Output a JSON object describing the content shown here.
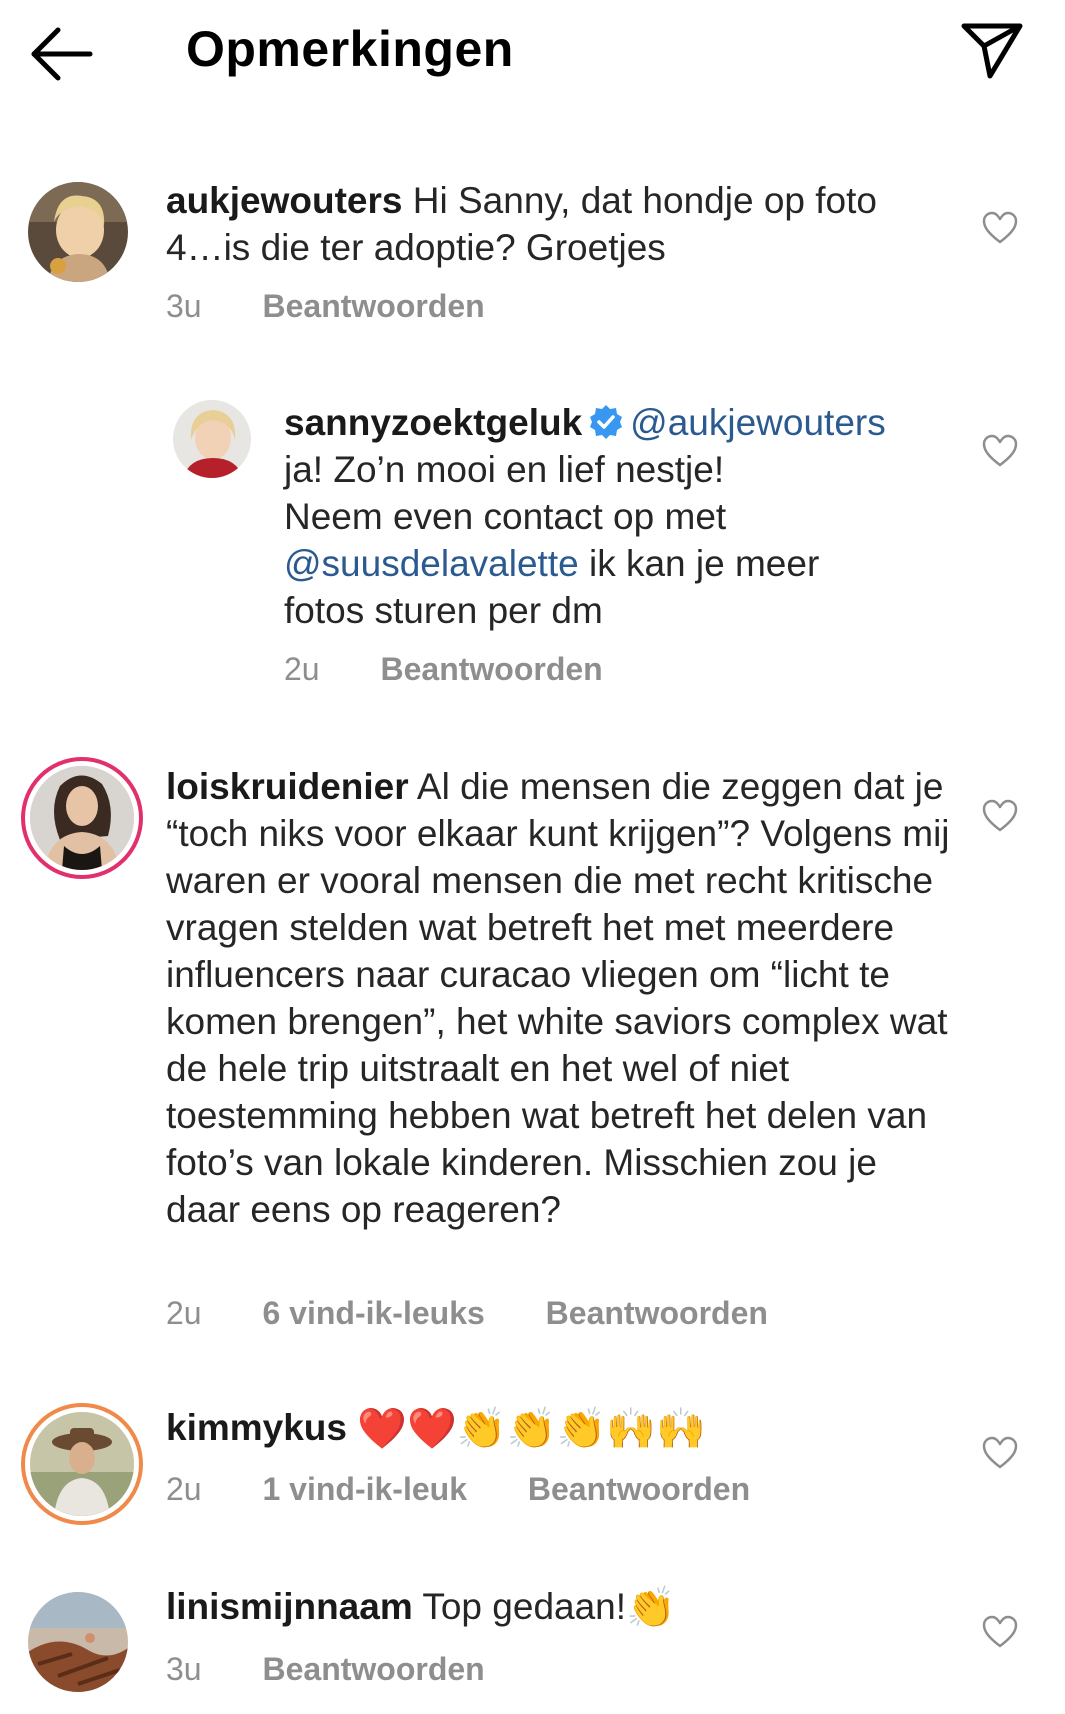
{
  "header": {
    "title": "Opmerkingen"
  },
  "comments": [
    {
      "username": "aukjewouters",
      "text": "Hi Sanny, dat hondje op foto 4…is die ter adoptie? Groetjes",
      "time": "3u",
      "reply_label": "Beantwoorden"
    },
    {
      "username": "sannyzoektgeluk",
      "mention": "@aukjewouters",
      "text_line1": "ja! Zo’n mooi en lief nestje!",
      "text_line2": "Neem even contact op met",
      "mention2": "@suusdelavalette",
      "text_line3": " ik kan je meer",
      "text_line4": "fotos sturen per dm",
      "time": "2u",
      "reply_label": "Beantwoorden"
    },
    {
      "username": "loiskruidenier",
      "text": "Al die mensen die zeggen dat je “toch niks voor elkaar kunt krijgen”? Volgens mij waren er vooral mensen die met recht kritische vragen stelden wat betreft het met meerdere influencers naar curacao vliegen om “licht te komen brengen”, het white saviors complex wat de hele trip uitstraalt en het wel of niet toestemming hebben wat betreft het delen van foto’s van lokale kinderen. Misschien zou je daar eens op reageren?",
      "time": "2u",
      "likes": "6 vind-ik-leuks",
      "reply_label": "Beantwoorden"
    },
    {
      "username": "kimmykus",
      "emojis": "❤️❤️👏👏👏🙌🙌",
      "time": "2u",
      "likes": "1 vind-ik-leuk",
      "reply_label": "Beantwoorden"
    },
    {
      "username": "linismijnnaam",
      "text": "Top gedaan!",
      "emoji": "👏",
      "time": "3u",
      "reply_label": "Beantwoorden"
    }
  ]
}
